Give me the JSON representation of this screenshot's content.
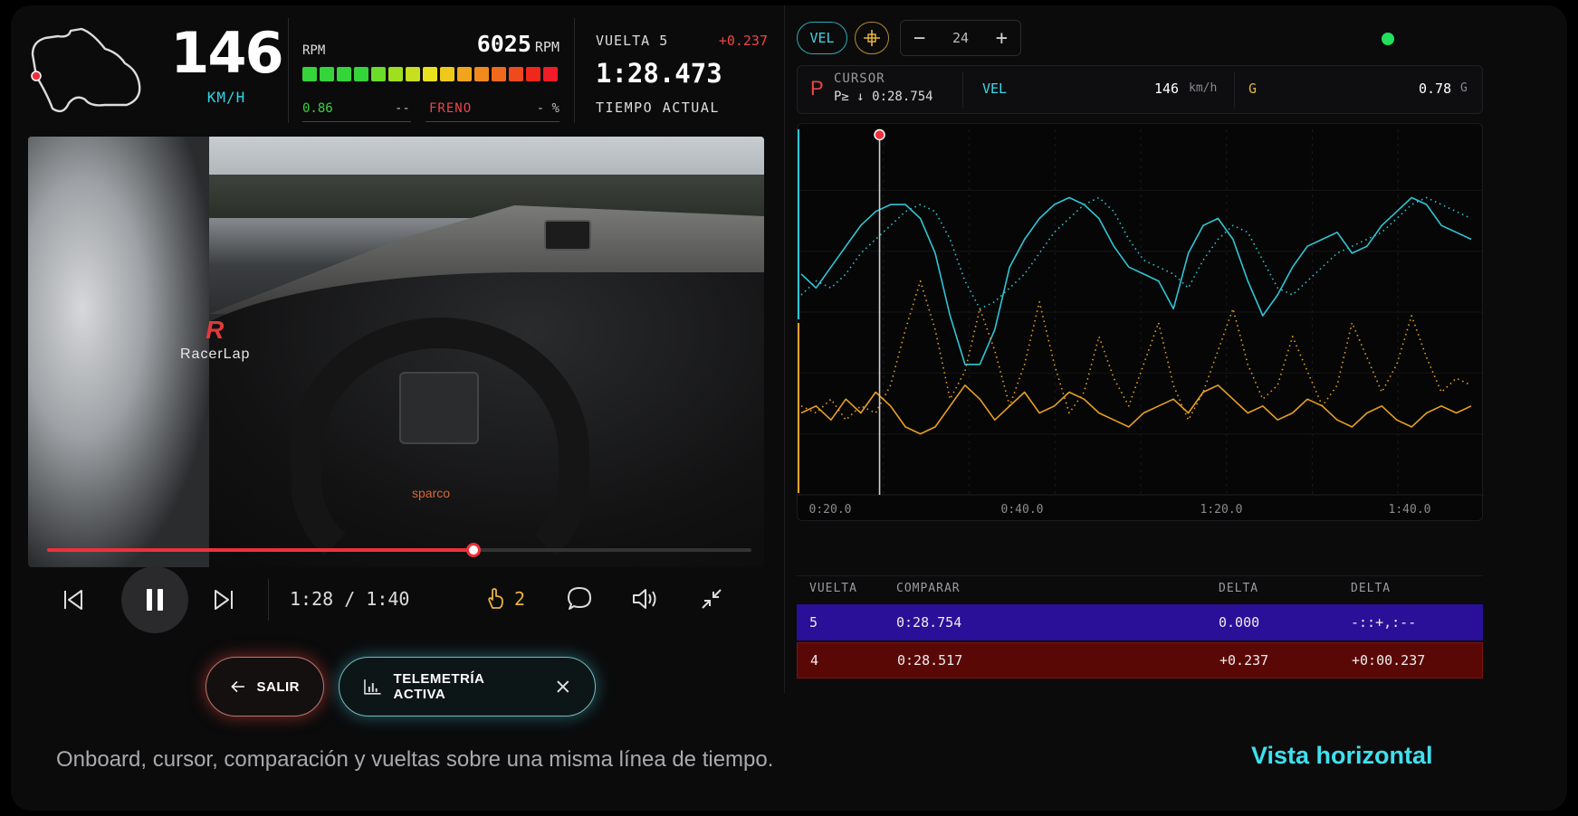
{
  "hud": {
    "speed": {
      "value": "146",
      "unit": "KM/H"
    },
    "rpm": {
      "label": "RPM",
      "value": "6025",
      "unit": "RPM",
      "throttle": "0.86",
      "throttle_pct": "--",
      "brake_label": "FRENO",
      "brake_pct": "- %",
      "led_colors": [
        "#35d43a",
        "#35d43a",
        "#35d43a",
        "#35d43a",
        "#6bdc2a",
        "#9ee020",
        "#c6e020",
        "#e8e31c",
        "#f0c81c",
        "#f0a61c",
        "#f08a1c",
        "#f06a1c",
        "#f04a1c",
        "#f0281c",
        "#f01c28"
      ]
    },
    "lap": {
      "label": "VUELTA 5",
      "delta": "+0.237",
      "time": "1:28.473",
      "caption": "TIEMPO ACTUAL"
    }
  },
  "video": {
    "overlay_logo": "RacerLap",
    "overlay_logo_mark": "R",
    "brand": "sparco",
    "progress": 0.605
  },
  "controls": {
    "time": "1:28 / 1:40",
    "likes": "2"
  },
  "buttons": {
    "exit": "SALIR",
    "telemetry": "TELEMETRÍA ACTIVA"
  },
  "caption": "Onboard, cursor, comparación y vueltas sobre una misma línea de tiempo.",
  "view_label": "Vista horizontal",
  "right": {
    "chip_vel": "VEL",
    "stepper_value": "24",
    "stepper_minus": "−",
    "stepper_plus": "+",
    "status_color": "#22e05a",
    "readout": {
      "badge": "P",
      "cursor_label": "CURSOR",
      "cursor_time": "P≥ ↓ 0:28.754",
      "vel_label": "VEL",
      "vel_value": "146",
      "vel_unit": "km/h",
      "g_label": "G",
      "g_value": "0.78",
      "g_unit": "G"
    }
  },
  "chart_data": {
    "type": "line",
    "x_ticks": [
      "0:20.0",
      "0:40.0",
      "1:20.0",
      "1:40.0"
    ],
    "cursor": 0.13,
    "series": [
      {
        "color": "#2fc6d6",
        "style": "solid",
        "values": [
          62,
          58,
          64,
          70,
          76,
          80,
          82,
          82,
          78,
          68,
          50,
          36,
          36,
          46,
          64,
          72,
          78,
          82,
          84,
          82,
          78,
          70,
          64,
          62,
          60,
          52,
          68,
          76,
          78,
          72,
          60,
          50,
          56,
          64,
          70,
          72,
          74,
          68,
          70,
          76,
          80,
          84,
          82,
          76,
          74,
          72
        ]
      },
      {
        "color": "#2fc6d6",
        "style": "dotted",
        "values": [
          56,
          60,
          58,
          62,
          68,
          72,
          76,
          80,
          82,
          80,
          72,
          60,
          52,
          54,
          58,
          62,
          68,
          74,
          78,
          82,
          84,
          80,
          72,
          66,
          64,
          62,
          58,
          66,
          72,
          76,
          74,
          66,
          58,
          56,
          60,
          64,
          68,
          70,
          72,
          74,
          78,
          82,
          84,
          82,
          80,
          78
        ]
      },
      {
        "color": "#e8a020",
        "style": "solid",
        "values": [
          22,
          24,
          20,
          26,
          22,
          28,
          24,
          18,
          16,
          18,
          24,
          30,
          26,
          20,
          24,
          28,
          22,
          24,
          28,
          26,
          22,
          20,
          18,
          22,
          24,
          26,
          22,
          28,
          30,
          26,
          22,
          24,
          20,
          22,
          26,
          24,
          20,
          18,
          22,
          24,
          20,
          18,
          22,
          24,
          22,
          24
        ]
      },
      {
        "color": "#e8a020",
        "style": "dotted",
        "values": [
          24,
          22,
          26,
          20,
          24,
          22,
          30,
          46,
          60,
          46,
          26,
          34,
          52,
          40,
          24,
          36,
          54,
          36,
          22,
          28,
          44,
          32,
          24,
          36,
          48,
          30,
          20,
          28,
          40,
          52,
          36,
          26,
          30,
          44,
          34,
          24,
          30,
          48,
          38,
          28,
          36,
          50,
          38,
          28,
          32,
          30
        ]
      }
    ]
  },
  "laps": {
    "headers": [
      "VUELTA",
      "COMPARAR",
      "DELTA",
      "DELTA"
    ],
    "rows": [
      {
        "lap": "5",
        "compare": "0:28.754",
        "delta": "0.000",
        "delta2": "-::+,:--"
      },
      {
        "lap": "4",
        "compare": "0:28.517",
        "delta": "+0.237",
        "delta2": "+0:00.237"
      }
    ]
  }
}
